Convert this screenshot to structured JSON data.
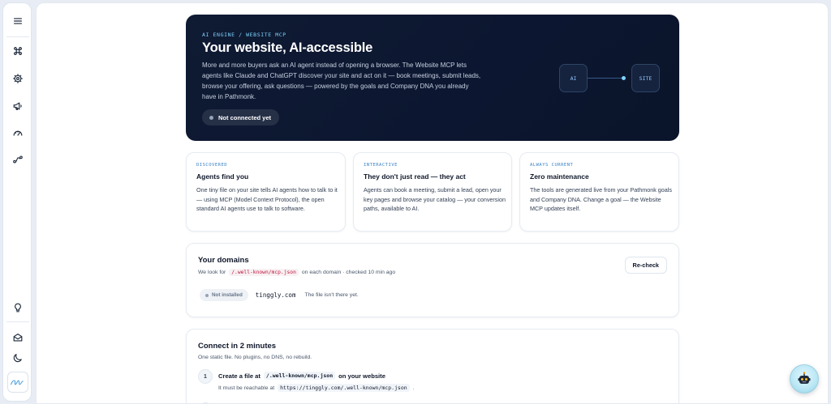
{
  "sidebar": {
    "icons": [
      "menu-icon",
      "command-icon",
      "chip-icon",
      "megaphone-icon",
      "gauge-icon",
      "route-icon",
      "lightbulb-icon",
      "mail-icon",
      "moon-icon"
    ],
    "brand_logo": "tinggly"
  },
  "hero": {
    "kicker": "AI ENGINE / WEBSITE MCP",
    "title": "Your website, AI-accessible",
    "description": "More and more buyers ask an AI agent instead of opening a browser. The Website MCP lets agents like Claude and ChatGPT discover your site and act on it — book meetings, submit leads, browse your offering, ask questions — powered by the goals and Company DNA you already have in Pathmonk.",
    "status": "Not connected yet",
    "diagram": {
      "left_node": "AI",
      "right_node": "SITE"
    }
  },
  "features": [
    {
      "kicker": "DISCOVERED",
      "title": "Agents find you",
      "description": "One tiny file on your site tells AI agents how to talk to it — using MCP (Model Context Protocol), the open standard AI agents use to talk to software."
    },
    {
      "kicker": "INTERACTIVE",
      "title": "They don't just read — they act",
      "description": "Agents can book a meeting, submit a lead, open your key pages and browse your catalog — your conversion paths, available to AI."
    },
    {
      "kicker": "ALWAYS CURRENT",
      "title": "Zero maintenance",
      "description": "The tools are generated live from your Pathmonk goals and Company DNA. Change a goal — the Website MCP updates itself."
    }
  ],
  "domains": {
    "title": "Your domains",
    "sub_prefix": "We look for",
    "sub_path": "/.well-known/mcp.json",
    "sub_suffix": "on each domain · checked 10 min ago",
    "recheck_label": "Re-check",
    "rows": [
      {
        "status": "Not installed",
        "domain": "tinggly.com",
        "note": "The file isn't there yet."
      }
    ]
  },
  "connect": {
    "title": "Connect in 2 minutes",
    "subtitle": "One static file. No plugins, no DNS, no rebuild.",
    "steps": [
      {
        "number": "1",
        "title_prefix": "Create a file at",
        "title_code": "/.well-known/mcp.json",
        "title_suffix": "on your website",
        "sub_prefix": "It must be reachable at",
        "sub_code": "https://tinggly.com/.well-known/mcp.json",
        "sub_suffix": "."
      }
    ]
  },
  "assistant": {
    "icon": "robot-icon"
  }
}
